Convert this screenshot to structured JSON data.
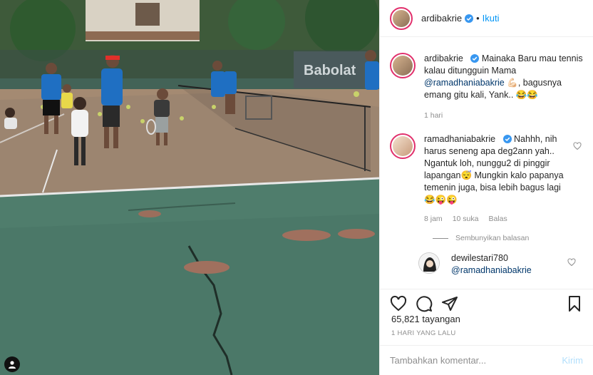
{
  "post": {
    "author": "ardibakrie",
    "follow_label": "Ikuti",
    "dot": "•"
  },
  "caption": {
    "username": "ardibakrie",
    "text_1": "Mainaka Baru mau tennis kalau ditungguin Mama",
    "mention": "@ramadhaniabakrie",
    "text_2": "💪🏻, bagusnya emang gitu kali, Yank.. 😂😂",
    "time": "1 hari"
  },
  "comment": {
    "username": "ramadhaniabakrie",
    "text": "Nahhh, nih harus seneng apa deg2ann yah.. Ngantuk loh, nunggu2 di pinggir lapangan😴 Mungkin kalo papanya temenin juga, bisa lebih bagus lagi😂😜😜",
    "time": "8 jam",
    "likes": "10 suka",
    "reply_label": "Balas",
    "hide_replies_label": "Sembunyikan balasan"
  },
  "reply": {
    "username": "dewilestari780",
    "mention": "@ramadhaniabakrie"
  },
  "stats": {
    "views": "65,821 tayangan",
    "date": "1 HARI YANG LALU"
  },
  "composer": {
    "placeholder": "Tambahkan komentar...",
    "post_label": "Kirim"
  },
  "media": {
    "banner_text": "Babolat"
  },
  "colors": {
    "accent": "#0095f6",
    "story_ring": "#e1306c",
    "court_green": "#4f7d6c",
    "court_clay": "#a48a72"
  }
}
